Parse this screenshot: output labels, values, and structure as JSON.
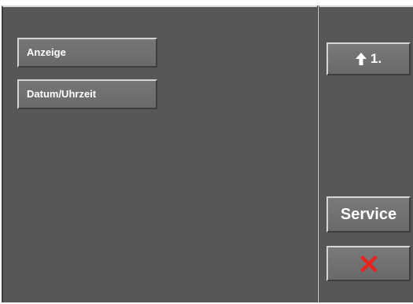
{
  "menu": {
    "items": [
      {
        "label": "Anzeige"
      },
      {
        "label": "Datum/Uhrzeit"
      }
    ]
  },
  "side": {
    "up_label": "1.",
    "up_icon": "arrow-up-icon",
    "service_label": "Service",
    "close_icon": "close-icon",
    "close_color": "#e8231e"
  }
}
